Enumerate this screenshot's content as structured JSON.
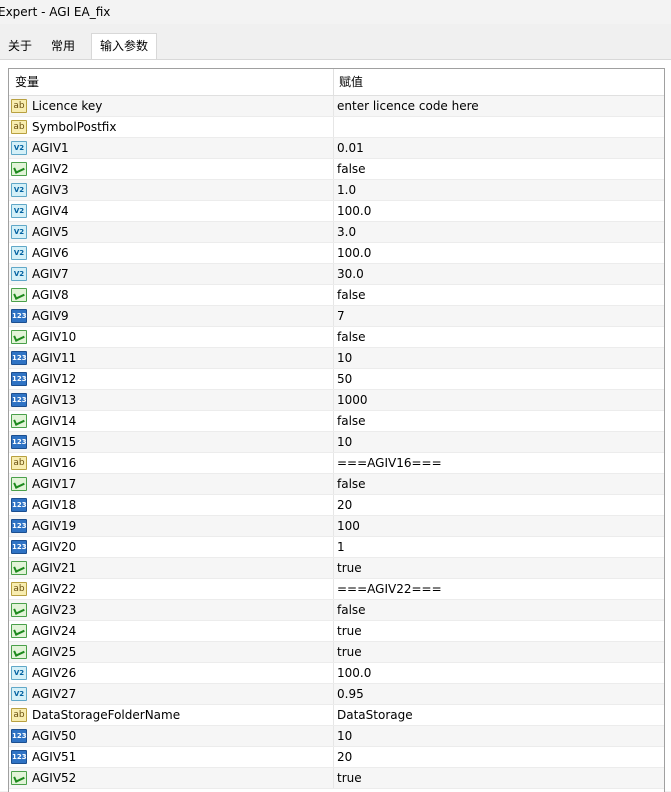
{
  "window": {
    "title": "Expert - AGI EA_fix"
  },
  "tabs": [
    {
      "label": "关于"
    },
    {
      "label": "常用"
    },
    {
      "label": "输入参数"
    }
  ],
  "grid": {
    "columns": {
      "variable": "变量",
      "value": "赋值"
    },
    "rows": [
      {
        "type": "string",
        "icon": "string-icon",
        "name": "Licence key",
        "value": "enter licence code here"
      },
      {
        "type": "string",
        "icon": "string-icon",
        "name": "SymbolPostfix",
        "value": ""
      },
      {
        "type": "double",
        "icon": "double-icon",
        "name": "AGIV1",
        "value": "0.01"
      },
      {
        "type": "bool",
        "icon": "bool-icon",
        "name": "AGIV2",
        "value": "false"
      },
      {
        "type": "double",
        "icon": "double-icon",
        "name": "AGIV3",
        "value": "1.0"
      },
      {
        "type": "double",
        "icon": "double-icon",
        "name": "AGIV4",
        "value": "100.0"
      },
      {
        "type": "double",
        "icon": "double-icon",
        "name": "AGIV5",
        "value": "3.0"
      },
      {
        "type": "double",
        "icon": "double-icon",
        "name": "AGIV6",
        "value": "100.0"
      },
      {
        "type": "double",
        "icon": "double-icon",
        "name": "AGIV7",
        "value": "30.0"
      },
      {
        "type": "bool",
        "icon": "bool-icon",
        "name": "AGIV8",
        "value": "false"
      },
      {
        "type": "int",
        "icon": "integer-icon",
        "name": "AGIV9",
        "value": "7"
      },
      {
        "type": "bool",
        "icon": "bool-icon",
        "name": "AGIV10",
        "value": "false"
      },
      {
        "type": "int",
        "icon": "integer-icon",
        "name": "AGIV11",
        "value": "10"
      },
      {
        "type": "int",
        "icon": "integer-icon",
        "name": "AGIV12",
        "value": "50"
      },
      {
        "type": "int",
        "icon": "integer-icon",
        "name": "AGIV13",
        "value": "1000"
      },
      {
        "type": "bool",
        "icon": "bool-icon",
        "name": "AGIV14",
        "value": "false"
      },
      {
        "type": "int",
        "icon": "integer-icon",
        "name": "AGIV15",
        "value": "10"
      },
      {
        "type": "string",
        "icon": "string-icon",
        "name": "AGIV16",
        "value": "===AGIV16==="
      },
      {
        "type": "bool",
        "icon": "bool-icon",
        "name": "AGIV17",
        "value": "false"
      },
      {
        "type": "int",
        "icon": "integer-icon",
        "name": "AGIV18",
        "value": "20"
      },
      {
        "type": "int",
        "icon": "integer-icon",
        "name": "AGIV19",
        "value": "100"
      },
      {
        "type": "int",
        "icon": "integer-icon",
        "name": "AGIV20",
        "value": "1"
      },
      {
        "type": "bool",
        "icon": "bool-icon",
        "name": "AGIV21",
        "value": "true"
      },
      {
        "type": "string",
        "icon": "string-icon",
        "name": "AGIV22",
        "value": "===AGIV22==="
      },
      {
        "type": "bool",
        "icon": "bool-icon",
        "name": "AGIV23",
        "value": "false"
      },
      {
        "type": "bool",
        "icon": "bool-icon",
        "name": "AGIV24",
        "value": "true"
      },
      {
        "type": "bool",
        "icon": "bool-icon",
        "name": "AGIV25",
        "value": "true"
      },
      {
        "type": "double",
        "icon": "double-icon",
        "name": "AGIV26",
        "value": "100.0"
      },
      {
        "type": "double",
        "icon": "double-icon",
        "name": "AGIV27",
        "value": "0.95"
      },
      {
        "type": "string",
        "icon": "string-icon",
        "name": "DataStorageFolderName",
        "value": "DataStorage"
      },
      {
        "type": "int",
        "icon": "integer-icon",
        "name": "AGIV50",
        "value": "10"
      },
      {
        "type": "int",
        "icon": "integer-icon",
        "name": "AGIV51",
        "value": "20"
      },
      {
        "type": "bool",
        "icon": "bool-icon",
        "name": "AGIV52",
        "value": "true"
      }
    ]
  },
  "icon_glyphs": {
    "string": "ab",
    "double": "V2",
    "int": "123",
    "bool": ""
  }
}
